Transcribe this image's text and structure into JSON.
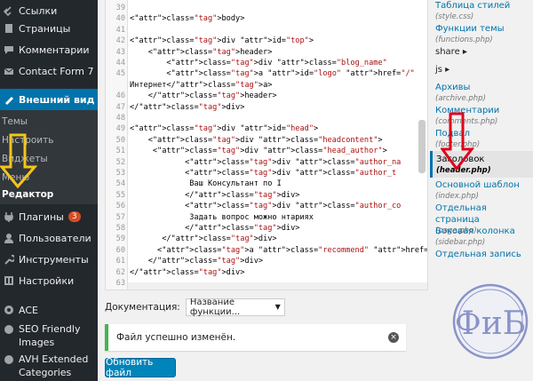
{
  "sidebar": {
    "items": [
      {
        "label": "Ссылки",
        "icon": "link-icon"
      },
      {
        "label": "Страницы",
        "icon": "page-icon"
      },
      {
        "label": "Комментарии",
        "icon": "comment-icon"
      },
      {
        "label": "Contact Form 7",
        "icon": "mail-icon"
      },
      {
        "label": "Внешний вид",
        "icon": "brush-icon"
      }
    ],
    "appearance_submenu": [
      "Темы",
      "Настроить",
      "Виджеты",
      "Меню",
      "Редактор"
    ],
    "items_after": [
      {
        "label": "Плагины",
        "icon": "plugin-icon",
        "badge": "3"
      },
      {
        "label": "Пользователи",
        "icon": "users-icon"
      },
      {
        "label": "Инструменты",
        "icon": "wrench-icon"
      },
      {
        "label": "Настройки",
        "icon": "settings-icon"
      },
      {
        "label": "ACE",
        "icon": "gear-icon"
      },
      {
        "label_line1": "SEO Friendly",
        "label_line2": "Images",
        "icon": "image-icon"
      },
      {
        "label_line1": "AVH Extended",
        "label_line2": "Categories",
        "icon": "category-icon"
      }
    ]
  },
  "editor": {
    "lines": [
      {
        "n": "39",
        "t": ""
      },
      {
        "n": "40",
        "t": "<body>"
      },
      {
        "n": "41",
        "t": ""
      },
      {
        "n": "42",
        "t": "<div id=\"top\">"
      },
      {
        "n": "43",
        "t": "    <header>"
      },
      {
        "n": "44",
        "t": "        <div class=\"blog_name\""
      },
      {
        "n": "45",
        "t": "        <a id=\"logo\" href=\"/\" "
      },
      {
        "n": "",
        "t": "Интернет</a>"
      },
      {
        "n": "46",
        "t": "    </header>"
      },
      {
        "n": "47",
        "t": "</div>"
      },
      {
        "n": "48",
        "t": ""
      },
      {
        "n": "49",
        "t": "<div id=\"head\">"
      },
      {
        "n": "50",
        "t": "    <div class=\"headcontent\">"
      },
      {
        "n": "51",
        "t": "     <div class=\"head_author\">"
      },
      {
        "n": "52",
        "t": "            <div class=\"author_na"
      },
      {
        "n": "53",
        "t": "            <div class=\"author_t"
      },
      {
        "n": "54",
        "t": "             Ваш Консультант по I"
      },
      {
        "n": "55",
        "t": "            </div>"
      },
      {
        "n": "56",
        "t": "            <div class=\"author_co"
      },
      {
        "n": "57",
        "t": "             Задать вопрос можно нтариях"
      },
      {
        "n": "58",
        "t": "            </div>"
      },
      {
        "n": "59",
        "t": "       </div>"
      },
      {
        "n": "60",
        "t": "      <a class=\"recommend\" href="
      },
      {
        "n": "61",
        "t": "    </div>"
      },
      {
        "n": "62",
        "t": "</div>"
      },
      {
        "n": "63",
        "t": ""
      }
    ]
  },
  "documentation": {
    "label": "Документация:",
    "selected": "Название функции..."
  },
  "notice": {
    "text": "Файл успешно изменён."
  },
  "update_button": {
    "label": "Обновить файл"
  },
  "files": [
    {
      "name": "Таблица стилей",
      "path": "(style.css)",
      "y": 0
    },
    {
      "name": "Функции темы",
      "path": "(functions.php)",
      "y": 1
    },
    {
      "name": "share ▸",
      "path": "",
      "folder": true
    },
    {
      "name": "js ▸",
      "path": "",
      "folder": true
    },
    {
      "name": "Архивы",
      "path": "(archive.php)"
    },
    {
      "name": "Комментарии",
      "path": "(comments.php)"
    },
    {
      "name": "Подвал",
      "path": "(footer.php)"
    },
    {
      "name": "Заголовок",
      "path": "(header.php)",
      "current": true
    },
    {
      "name": "Основной шаблон",
      "path": "(index.php)"
    },
    {
      "name": "Отдельная страница",
      "path": "(page.php)"
    },
    {
      "name": "Боковая колонка",
      "path": "(sidebar.php)"
    },
    {
      "name": "Отдельная запись",
      "path": ""
    }
  ],
  "logo": {
    "text": "ФиБ"
  },
  "colors": {
    "accent": "#0073aa",
    "sidebar": "#23282d",
    "success": "#46b450",
    "arrow_red": "#e0001a",
    "arrow_yellow": "#f5c518"
  }
}
